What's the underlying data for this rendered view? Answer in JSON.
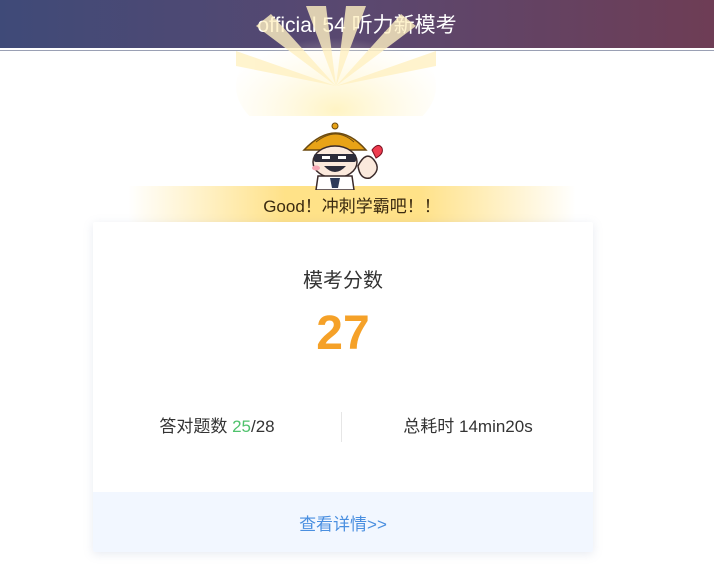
{
  "header": {
    "title": "official 54 听力新模考"
  },
  "result": {
    "banner": "Good！冲刺学霸吧！！",
    "score_label": "模考分数",
    "score": "27",
    "correct_label": "答对题数 ",
    "correct_count": "25",
    "total_suffix": "/28",
    "time_label": "总耗时 ",
    "time_value": "14min20s",
    "details_link": "查看详情>>"
  },
  "colors": {
    "header_gradient_start": "#3f4a78",
    "header_gradient_end": "#6e3d55",
    "score": "#f5a128",
    "correct": "#4fc26c",
    "link": "#4a8fe0",
    "footer_bg": "#f2f7ff"
  },
  "icons": {
    "mascot": "mascot-illustration"
  }
}
